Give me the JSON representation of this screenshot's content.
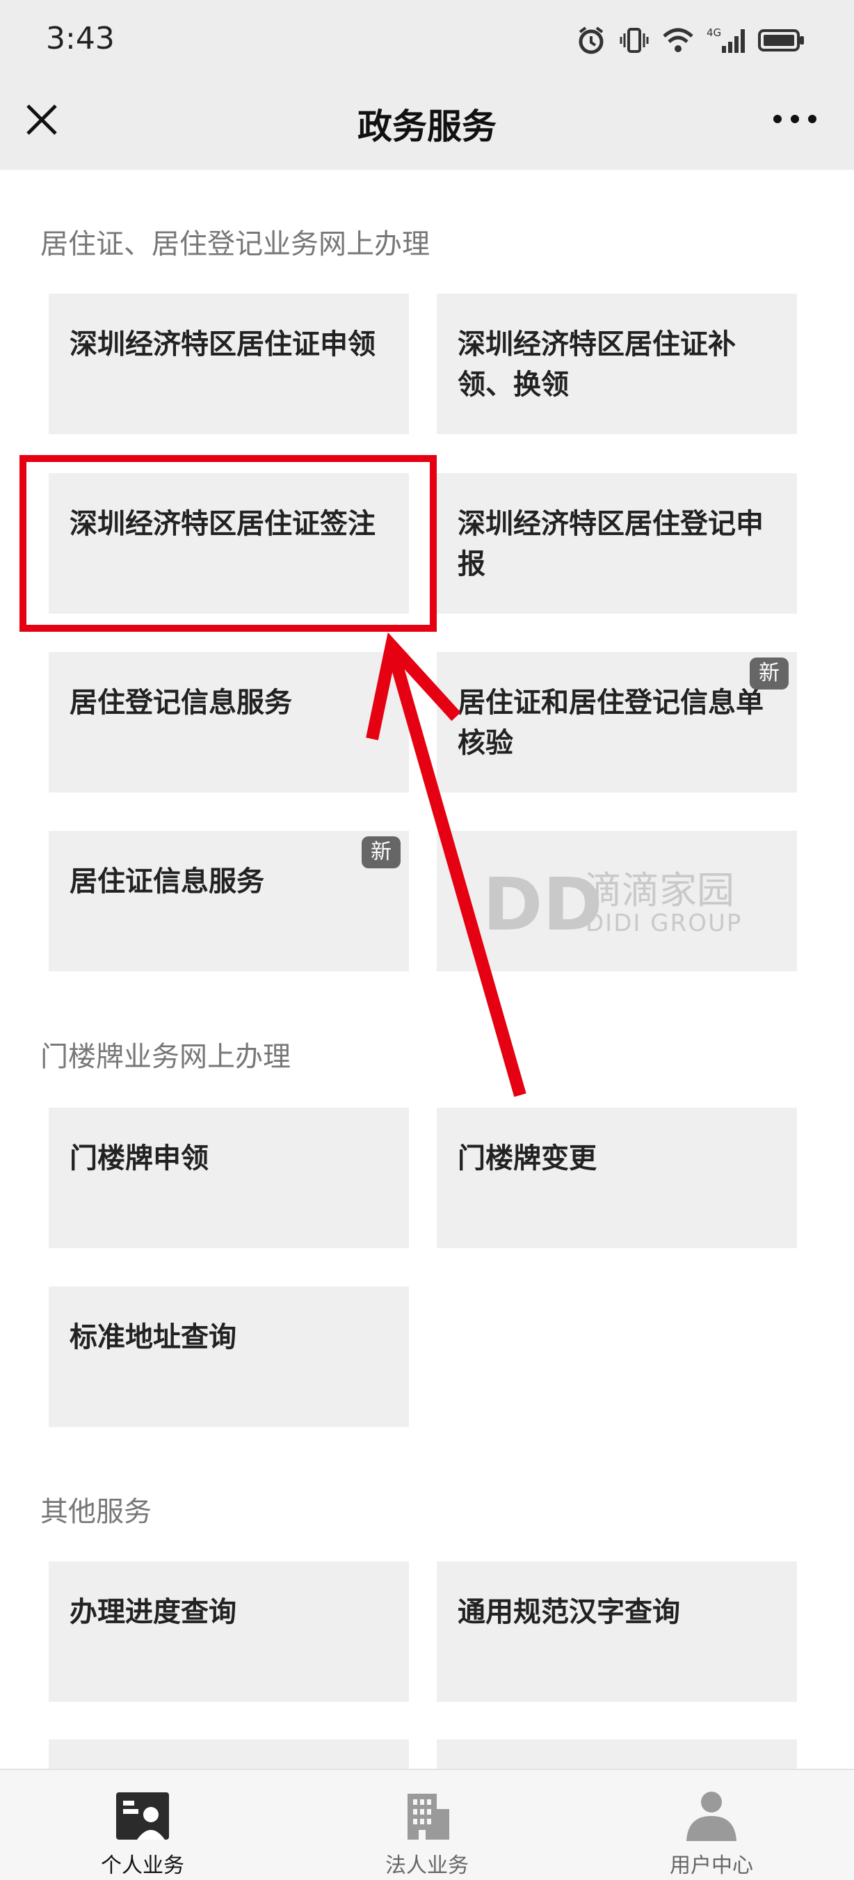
{
  "status_bar": {
    "time": "3:43",
    "network": "4G"
  },
  "header": {
    "title": "政务服务"
  },
  "sections": [
    {
      "title": "居住证、居住登记业务网上办理"
    },
    {
      "title": "门楼牌业务网上办理"
    },
    {
      "title": "其他服务"
    }
  ],
  "cards": [
    {
      "label": "深圳经济特区居住证申领"
    },
    {
      "label": "深圳经济特区居住证补领、换领"
    },
    {
      "label": "深圳经济特区居住证签注"
    },
    {
      "label": "深圳经济特区居住登记申报"
    },
    {
      "label": "居住登记信息服务"
    },
    {
      "label": "居住证和居住登记信息单核验",
      "badge": "新"
    },
    {
      "label": "居住证信息服务",
      "badge": "新"
    },
    {
      "label": "门楼牌申领"
    },
    {
      "label": "门楼牌变更"
    },
    {
      "label": "标准地址查询"
    },
    {
      "label": "办理进度查询"
    },
    {
      "label": "通用规范汉字查询"
    }
  ],
  "watermark": {
    "mark": "DD",
    "name": "滴滴家园",
    "sub": "DIDI GROUP"
  },
  "bottom_nav": [
    {
      "label": "个人业务",
      "icon": "person-card-icon",
      "active": true
    },
    {
      "label": "法人业务",
      "icon": "building-icon",
      "active": false
    },
    {
      "label": "用户中心",
      "icon": "user-icon",
      "active": false
    }
  ],
  "colors": {
    "highlight": "#e50012",
    "card_bg": "#efefef",
    "header_bg": "#ededed"
  }
}
